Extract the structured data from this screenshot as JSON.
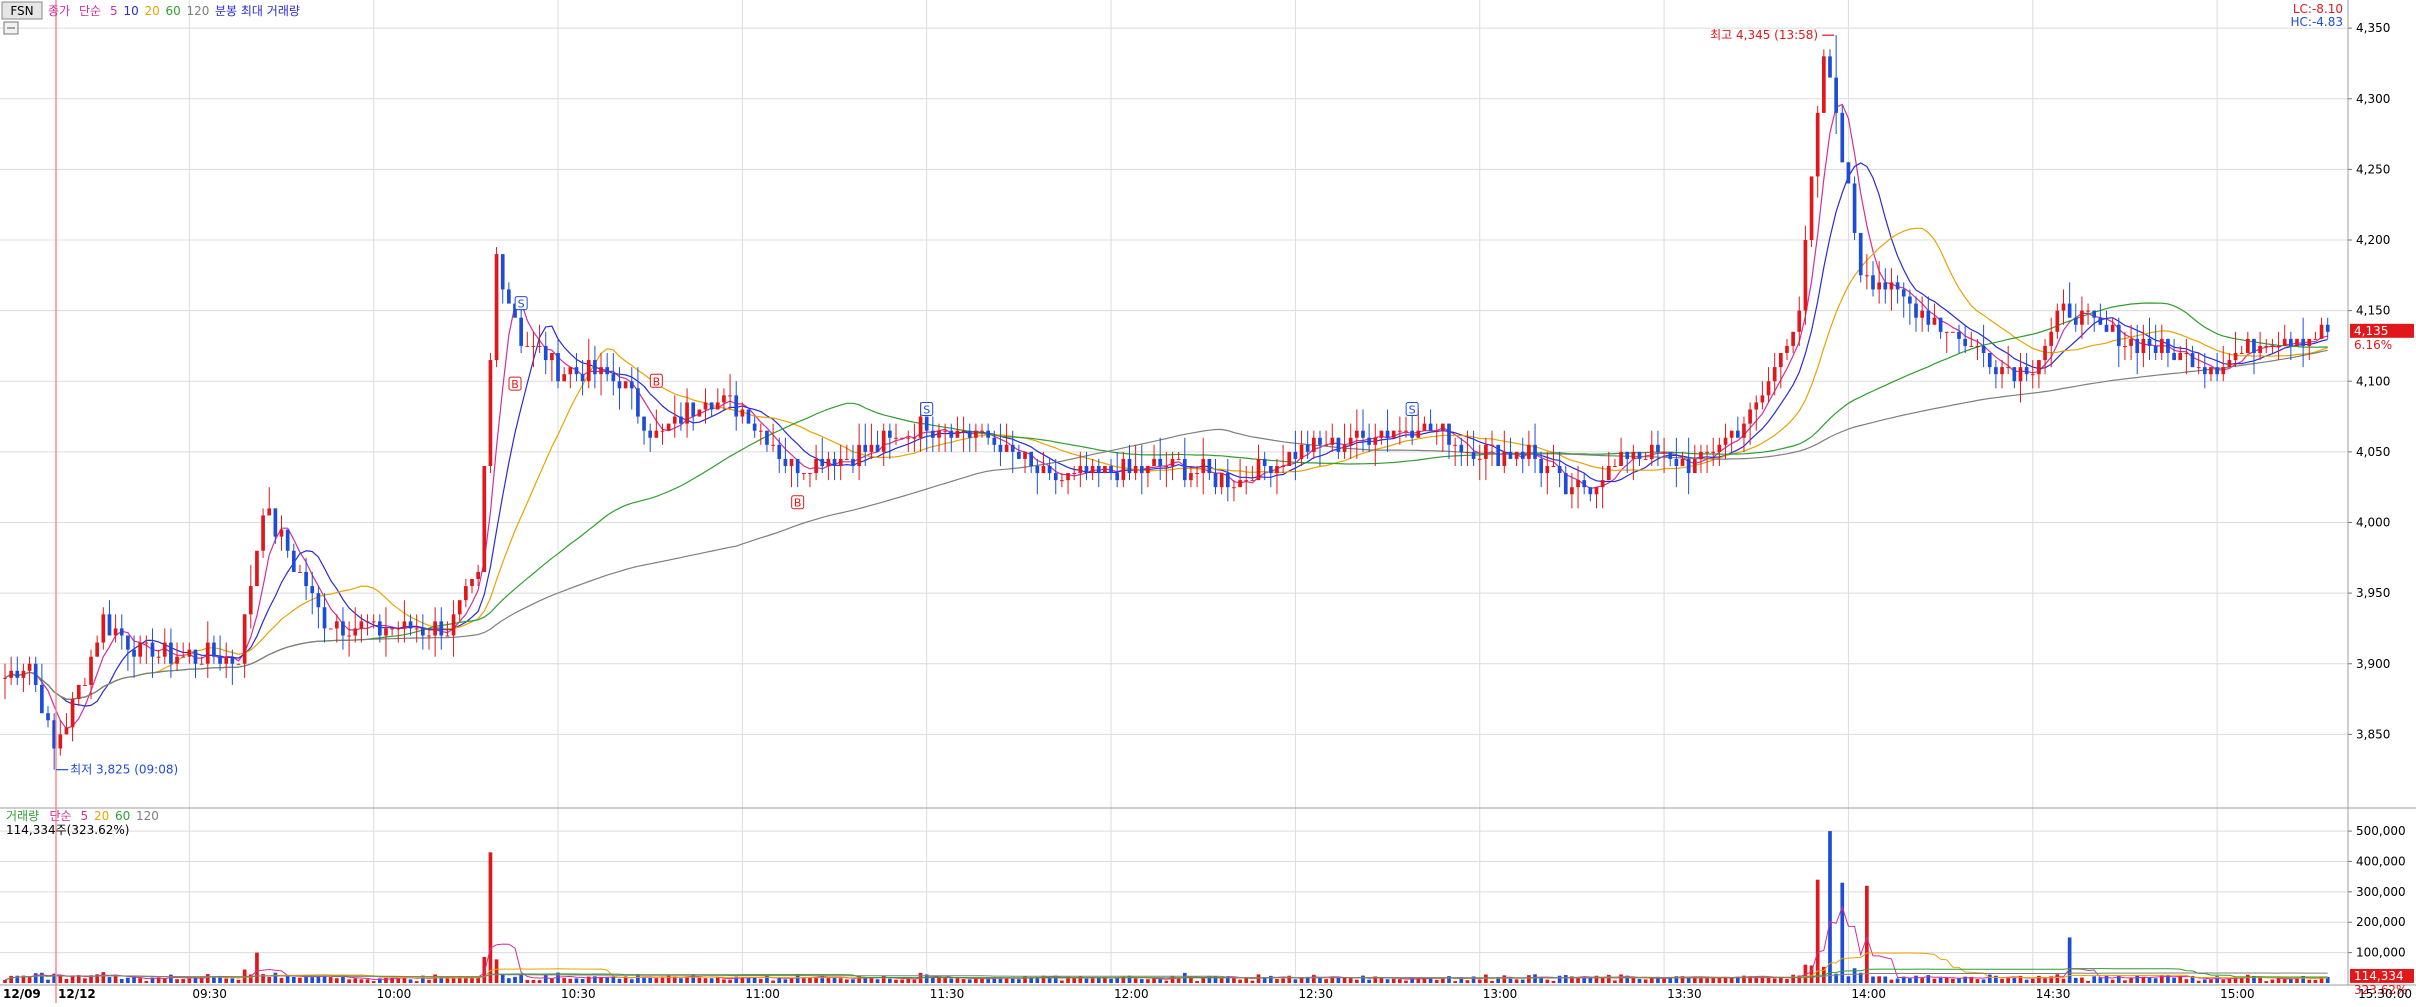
{
  "header": {
    "symbol": "FSN",
    "legend": [
      {
        "text": "종가",
        "color": "#d22f9c"
      },
      {
        "text": "단순",
        "color": "#d22f9c"
      },
      {
        "text": "5",
        "color": "#d22f9c"
      },
      {
        "text": "10",
        "color": "#2b2bd6"
      },
      {
        "text": "20",
        "color": "#e8a400"
      },
      {
        "text": "60",
        "color": "#2f9e2f"
      },
      {
        "text": "120",
        "color": "#7f7f7f"
      },
      {
        "text": "분봉 최대 거래량",
        "color": "#2b2bd6"
      }
    ],
    "lc": "LC:-8.10",
    "hc": "HC:-4.83"
  },
  "volume_header": {
    "legend": [
      {
        "text": "거래량",
        "color": "#2f9e2f"
      },
      {
        "text": "단순",
        "color": "#d22f9c"
      },
      {
        "text": "5",
        "color": "#d22f9c"
      },
      {
        "text": "20",
        "color": "#e8a400"
      },
      {
        "text": "60",
        "color": "#2f9e2f"
      },
      {
        "text": "120",
        "color": "#7f7f7f"
      }
    ],
    "current": "114,334주(323.62%)"
  },
  "price_tag": {
    "value": "4,135",
    "pct": "6.16%"
  },
  "volume_tag": {
    "value": "114,334",
    "pct": "323.62%"
  },
  "annotations": {
    "high": "최고 4,345 (13:58)",
    "low": "최저 3,825 (09:08)"
  },
  "date_labels": [
    "12/09",
    "12/12"
  ],
  "time_axis_end": "15:30:00",
  "colors": {
    "up": "#e0181c",
    "down": "#1d4dd8",
    "ma5": "#d22f9c",
    "ma10": "#2b2bd6",
    "ma20": "#e8a400",
    "ma60": "#2f9e2f",
    "ma120": "#7f7f7f",
    "grid": "#dcdcdc"
  },
  "chart_data": {
    "type": "candlestick",
    "price_axis": {
      "ticks": [
        3850,
        3900,
        3950,
        4000,
        4050,
        4100,
        4150,
        4200,
        4250,
        4300,
        4350
      ],
      "ylim": [
        3800,
        4360
      ]
    },
    "volume_axis": {
      "ticks": [
        100000,
        200000,
        300000,
        400000,
        500000
      ],
      "ylim": [
        0,
        520000
      ]
    },
    "time_ticks": [
      "09:30",
      "10:00",
      "10:30",
      "11:00",
      "11:30",
      "12:00",
      "12:30",
      "13:00",
      "13:30",
      "14:00",
      "14:30",
      "15:00"
    ],
    "anchors": [
      {
        "t": "09:00",
        "close": 3890
      },
      {
        "t": "09:04",
        "close": 3900
      },
      {
        "t": "09:08",
        "close": 3840
      },
      {
        "t": "09:12",
        "close": 3880
      },
      {
        "t": "09:16",
        "close": 3930
      },
      {
        "t": "09:22",
        "close": 3910
      },
      {
        "t": "09:30",
        "close": 3905
      },
      {
        "t": "09:38",
        "close": 3905
      },
      {
        "t": "09:42",
        "close": 4010
      },
      {
        "t": "09:46",
        "close": 3980
      },
      {
        "t": "09:52",
        "close": 3930
      },
      {
        "t": "10:00",
        "close": 3925
      },
      {
        "t": "10:12",
        "close": 3925
      },
      {
        "t": "10:17",
        "close": 3960
      },
      {
        "t": "10:20",
        "close": 4190
      },
      {
        "t": "10:24",
        "close": 4130
      },
      {
        "t": "10:30",
        "close": 4110
      },
      {
        "t": "10:40",
        "close": 4100
      },
      {
        "t": "10:46",
        "close": 4060
      },
      {
        "t": "10:54",
        "close": 4090
      },
      {
        "t": "11:00",
        "close": 4080
      },
      {
        "t": "11:08",
        "close": 4040
      },
      {
        "t": "11:20",
        "close": 4050
      },
      {
        "t": "11:30",
        "close": 4070
      },
      {
        "t": "11:40",
        "close": 4060
      },
      {
        "t": "11:50",
        "close": 4030
      },
      {
        "t": "12:00",
        "close": 4035
      },
      {
        "t": "12:10",
        "close": 4040
      },
      {
        "t": "12:20",
        "close": 4030
      },
      {
        "t": "12:30",
        "close": 4050
      },
      {
        "t": "12:40",
        "close": 4060
      },
      {
        "t": "12:50",
        "close": 4070
      },
      {
        "t": "13:00",
        "close": 4050
      },
      {
        "t": "13:08",
        "close": 4050
      },
      {
        "t": "13:15",
        "close": 4020
      },
      {
        "t": "13:25",
        "close": 4050
      },
      {
        "t": "13:35",
        "close": 4040
      },
      {
        "t": "13:45",
        "close": 4080
      },
      {
        "t": "13:52",
        "close": 4150
      },
      {
        "t": "13:56",
        "close": 4330
      },
      {
        "t": "13:58",
        "close": 4290
      },
      {
        "t": "14:02",
        "close": 4180
      },
      {
        "t": "14:08",
        "close": 4160
      },
      {
        "t": "14:15",
        "close": 4140
      },
      {
        "t": "14:25",
        "close": 4110
      },
      {
        "t": "14:30",
        "close": 4110
      },
      {
        "t": "14:35",
        "close": 4150
      },
      {
        "t": "14:45",
        "close": 4130
      },
      {
        "t": "15:00",
        "close": 4110
      },
      {
        "t": "15:08",
        "close": 4130
      },
      {
        "t": "15:18",
        "close": 4135
      }
    ],
    "volume_spikes": [
      {
        "t": "10:19",
        "volume": 430000
      },
      {
        "t": "13:57",
        "volume": 500000
      },
      {
        "t": "13:55",
        "volume": 340000
      },
      {
        "t": "13:59",
        "volume": 330000
      },
      {
        "t": "14:03",
        "volume": 320000
      },
      {
        "t": "14:36",
        "volume": 150000
      },
      {
        "t": "09:41",
        "volume": 100000
      },
      {
        "t": "15:19",
        "volume": 114334
      }
    ],
    "ma_periods": [
      5,
      10,
      20,
      60,
      120
    ],
    "high": {
      "t": "13:58",
      "value": 4345
    },
    "low": {
      "t": "09:08",
      "value": 3825
    },
    "last": {
      "t": "15:19",
      "value": 4135
    },
    "signals": [
      {
        "t": "10:24",
        "type": "S",
        "price": 4155
      },
      {
        "t": "11:30",
        "type": "S",
        "price": 4080
      },
      {
        "t": "12:49",
        "type": "S",
        "price": 4080
      },
      {
        "t": "10:23",
        "type": "B",
        "price": 4098
      },
      {
        "t": "10:46",
        "type": "B",
        "price": 4100
      },
      {
        "t": "11:09",
        "type": "B",
        "price": 4014
      }
    ]
  }
}
